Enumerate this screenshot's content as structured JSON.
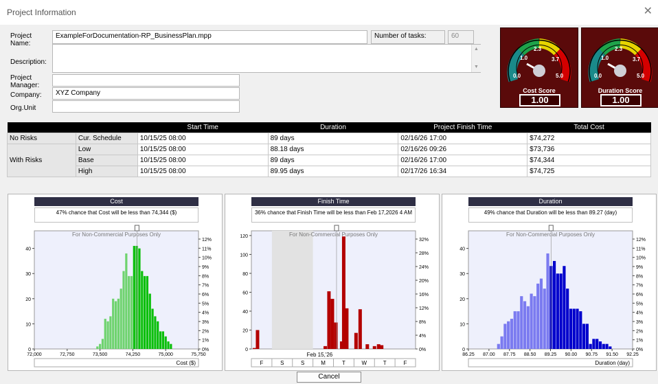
{
  "window": {
    "title": "Project Information",
    "close_glyph": "✕"
  },
  "form": {
    "project_name_label": "Project Name:",
    "project_name_value": "ExampleForDocumentation-RP_BusinessPlan.mpp",
    "num_tasks_label": "Number of tasks:",
    "num_tasks_value": "60",
    "description_label": "Description:",
    "description_value": "",
    "manager_label": "Project Manager:",
    "manager_value": "",
    "company_label": "Company:",
    "company_value": "XYZ Company",
    "org_unit_label": "Org.Unit",
    "org_unit_value": ""
  },
  "gauges": [
    {
      "title": "Cost Score",
      "value": "1.00",
      "ticks": [
        "0.0",
        "1.0",
        "2.3",
        "3.7",
        "5.0"
      ],
      "reading": 1.0
    },
    {
      "title": "Duration Score",
      "value": "1.00",
      "ticks": [
        "0.0",
        "1.0",
        "2.3",
        "3.7",
        "5.0"
      ],
      "reading": 1.0
    }
  ],
  "summary": {
    "headers": [
      "",
      "",
      "Start Time",
      "Duration",
      "Project Finish Time",
      "Total Cost"
    ],
    "rows": [
      {
        "group": "No Risks",
        "scenario": "Cur. Schedule",
        "start": "10/15/25 08:00",
        "duration": "89 days",
        "finish": "02/16/26 17:00",
        "cost": "$74,272"
      },
      {
        "group": "With Risks",
        "scenario": "Low",
        "start": "10/15/25 08:00",
        "duration": "88.18 days",
        "finish": "02/16/26 09:26",
        "cost": "$73,736"
      },
      {
        "group": "",
        "scenario": "Base",
        "start": "10/15/25 08:00",
        "duration": "89 days",
        "finish": "02/16/26 17:00",
        "cost": "$74,344"
      },
      {
        "group": "",
        "scenario": "High",
        "start": "10/15/25 08:00",
        "duration": "89.95 days",
        "finish": "02/17/26 16:34",
        "cost": "$74,725"
      }
    ]
  },
  "buttons": {
    "cancel": "Cancel"
  },
  "colors": {
    "cost_light": "#6fd36f",
    "cost_dark": "#0bbf0b",
    "finish": "#b30000",
    "duration_light": "#7b7bf0",
    "duration_dark": "#0000cc"
  },
  "chart_data": [
    {
      "type": "bar",
      "title": "Cost",
      "subtitle": "47% chance that Cost will be less than 74,344 ($)",
      "watermark": "For Non-Commercial Purposes Only",
      "xlabel": "Cost ($)",
      "x_ticks": [
        "72,000",
        "72,750",
        "73,500",
        "74,250",
        "75,000",
        "75,750"
      ],
      "xlim": [
        72000,
        75750
      ],
      "y_ticks": [
        "0",
        "10",
        "20",
        "30",
        "40"
      ],
      "ylim": [
        0,
        47
      ],
      "y2_ticks": [
        "0%",
        "1%",
        "2%",
        "3%",
        "4%",
        "5%",
        "6%",
        "7%",
        "8%",
        "9%",
        "10%",
        "11%",
        "12%"
      ],
      "marker_x": 74344,
      "bins": [
        {
          "x": 73440,
          "value": 1,
          "tone": "light"
        },
        {
          "x": 73500,
          "value": 2,
          "tone": "light"
        },
        {
          "x": 73560,
          "value": 4,
          "tone": "light"
        },
        {
          "x": 73620,
          "value": 12,
          "tone": "light"
        },
        {
          "x": 73680,
          "value": 11,
          "tone": "light"
        },
        {
          "x": 73740,
          "value": 13,
          "tone": "light"
        },
        {
          "x": 73800,
          "value": 20,
          "tone": "light"
        },
        {
          "x": 73860,
          "value": 19,
          "tone": "light"
        },
        {
          "x": 73920,
          "value": 20,
          "tone": "light"
        },
        {
          "x": 73980,
          "value": 24,
          "tone": "light"
        },
        {
          "x": 74040,
          "value": 31,
          "tone": "light"
        },
        {
          "x": 74100,
          "value": 38,
          "tone": "light"
        },
        {
          "x": 74160,
          "value": 29,
          "tone": "light"
        },
        {
          "x": 74220,
          "value": 29,
          "tone": "light"
        },
        {
          "x": 74280,
          "value": 41,
          "tone": "dark"
        },
        {
          "x": 74340,
          "value": 41,
          "tone": "dark"
        },
        {
          "x": 74400,
          "value": 40,
          "tone": "dark"
        },
        {
          "x": 74460,
          "value": 31,
          "tone": "dark"
        },
        {
          "x": 74520,
          "value": 29,
          "tone": "dark"
        },
        {
          "x": 74580,
          "value": 29,
          "tone": "dark"
        },
        {
          "x": 74640,
          "value": 22,
          "tone": "dark"
        },
        {
          "x": 74700,
          "value": 16,
          "tone": "dark"
        },
        {
          "x": 74760,
          "value": 13,
          "tone": "dark"
        },
        {
          "x": 74820,
          "value": 11,
          "tone": "dark"
        },
        {
          "x": 74880,
          "value": 7,
          "tone": "dark"
        },
        {
          "x": 74940,
          "value": 7,
          "tone": "dark"
        },
        {
          "x": 75000,
          "value": 5,
          "tone": "dark"
        },
        {
          "x": 75060,
          "value": 3,
          "tone": "dark"
        },
        {
          "x": 75120,
          "value": 2,
          "tone": "dark"
        }
      ]
    },
    {
      "type": "bar",
      "title": "Finish Time",
      "subtitle": "36% chance that Finish Time will be less than Feb 17,2026 4 AM",
      "watermark": "For Non-Commercial Purposes Only",
      "date_label": "Feb 15,'26",
      "day_labels": [
        "F",
        "S",
        "S",
        "M",
        "T",
        "W",
        "T",
        "F"
      ],
      "xlim": [
        0,
        8
      ],
      "weekend_shade": [
        1,
        3
      ],
      "y_ticks": [
        "0",
        "20",
        "40",
        "60",
        "80",
        "100",
        "120"
      ],
      "ylim": [
        0,
        125
      ],
      "y2_ticks": [
        "0%",
        "4%",
        "8%",
        "12%",
        "16%",
        "20%",
        "24%",
        "28%",
        "32%"
      ],
      "marker_x": 4.15,
      "bins": [
        {
          "x": 0.15,
          "value": 1
        },
        {
          "x": 0.3,
          "value": 20
        },
        {
          "x": 3.6,
          "value": 3
        },
        {
          "x": 3.78,
          "value": 61
        },
        {
          "x": 3.95,
          "value": 53
        },
        {
          "x": 4.12,
          "value": 28
        },
        {
          "x": 4.4,
          "value": 8
        },
        {
          "x": 4.5,
          "value": 119
        },
        {
          "x": 4.65,
          "value": 43
        },
        {
          "x": 5.1,
          "value": 17
        },
        {
          "x": 5.3,
          "value": 42
        },
        {
          "x": 5.65,
          "value": 5
        },
        {
          "x": 6.0,
          "value": 3
        },
        {
          "x": 6.2,
          "value": 5
        },
        {
          "x": 6.35,
          "value": 4
        }
      ]
    },
    {
      "type": "bar",
      "title": "Duration",
      "subtitle": "49% chance that Duration will be less than 89.27 (day)",
      "watermark": "For Non-Commercial Purposes Only",
      "xlabel": "Duration (day)",
      "x_ticks": [
        "86.25",
        "87.00",
        "87.75",
        "88.50",
        "89.25",
        "90.00",
        "90.75",
        "91.50",
        "92.25"
      ],
      "xlim": [
        86.25,
        92.25
      ],
      "y_ticks": [
        "0",
        "10",
        "20",
        "30",
        "40"
      ],
      "ylim": [
        0,
        47
      ],
      "y2_ticks": [
        "0%",
        "1%",
        "2%",
        "3%",
        "4%",
        "5%",
        "6%",
        "7%",
        "8%",
        "9%",
        "10%",
        "11%",
        "12%"
      ],
      "marker_x": 89.27,
      "bins": [
        {
          "x": 87.35,
          "value": 2,
          "tone": "light"
        },
        {
          "x": 87.47,
          "value": 5,
          "tone": "light"
        },
        {
          "x": 87.59,
          "value": 10,
          "tone": "light"
        },
        {
          "x": 87.71,
          "value": 11,
          "tone": "light"
        },
        {
          "x": 87.83,
          "value": 12,
          "tone": "light"
        },
        {
          "x": 87.95,
          "value": 15,
          "tone": "light"
        },
        {
          "x": 88.07,
          "value": 15,
          "tone": "light"
        },
        {
          "x": 88.19,
          "value": 21,
          "tone": "light"
        },
        {
          "x": 88.31,
          "value": 19,
          "tone": "light"
        },
        {
          "x": 88.43,
          "value": 17,
          "tone": "light"
        },
        {
          "x": 88.55,
          "value": 22,
          "tone": "light"
        },
        {
          "x": 88.67,
          "value": 21,
          "tone": "light"
        },
        {
          "x": 88.79,
          "value": 26,
          "tone": "light"
        },
        {
          "x": 88.91,
          "value": 28,
          "tone": "light"
        },
        {
          "x": 89.03,
          "value": 24,
          "tone": "light"
        },
        {
          "x": 89.15,
          "value": 38,
          "tone": "light"
        },
        {
          "x": 89.27,
          "value": 33,
          "tone": "dark"
        },
        {
          "x": 89.39,
          "value": 35,
          "tone": "dark"
        },
        {
          "x": 89.51,
          "value": 30,
          "tone": "dark"
        },
        {
          "x": 89.63,
          "value": 30,
          "tone": "dark"
        },
        {
          "x": 89.75,
          "value": 33,
          "tone": "dark"
        },
        {
          "x": 89.87,
          "value": 24,
          "tone": "dark"
        },
        {
          "x": 89.99,
          "value": 16,
          "tone": "dark"
        },
        {
          "x": 90.11,
          "value": 16,
          "tone": "dark"
        },
        {
          "x": 90.23,
          "value": 16,
          "tone": "dark"
        },
        {
          "x": 90.35,
          "value": 15,
          "tone": "dark"
        },
        {
          "x": 90.47,
          "value": 10,
          "tone": "dark"
        },
        {
          "x": 90.59,
          "value": 10,
          "tone": "dark"
        },
        {
          "x": 90.71,
          "value": 2,
          "tone": "dark"
        },
        {
          "x": 90.83,
          "value": 4,
          "tone": "dark"
        },
        {
          "x": 90.95,
          "value": 4,
          "tone": "dark"
        },
        {
          "x": 91.07,
          "value": 3,
          "tone": "dark"
        },
        {
          "x": 91.19,
          "value": 2,
          "tone": "dark"
        },
        {
          "x": 91.31,
          "value": 2,
          "tone": "dark"
        },
        {
          "x": 91.43,
          "value": 1,
          "tone": "dark"
        }
      ]
    }
  ]
}
